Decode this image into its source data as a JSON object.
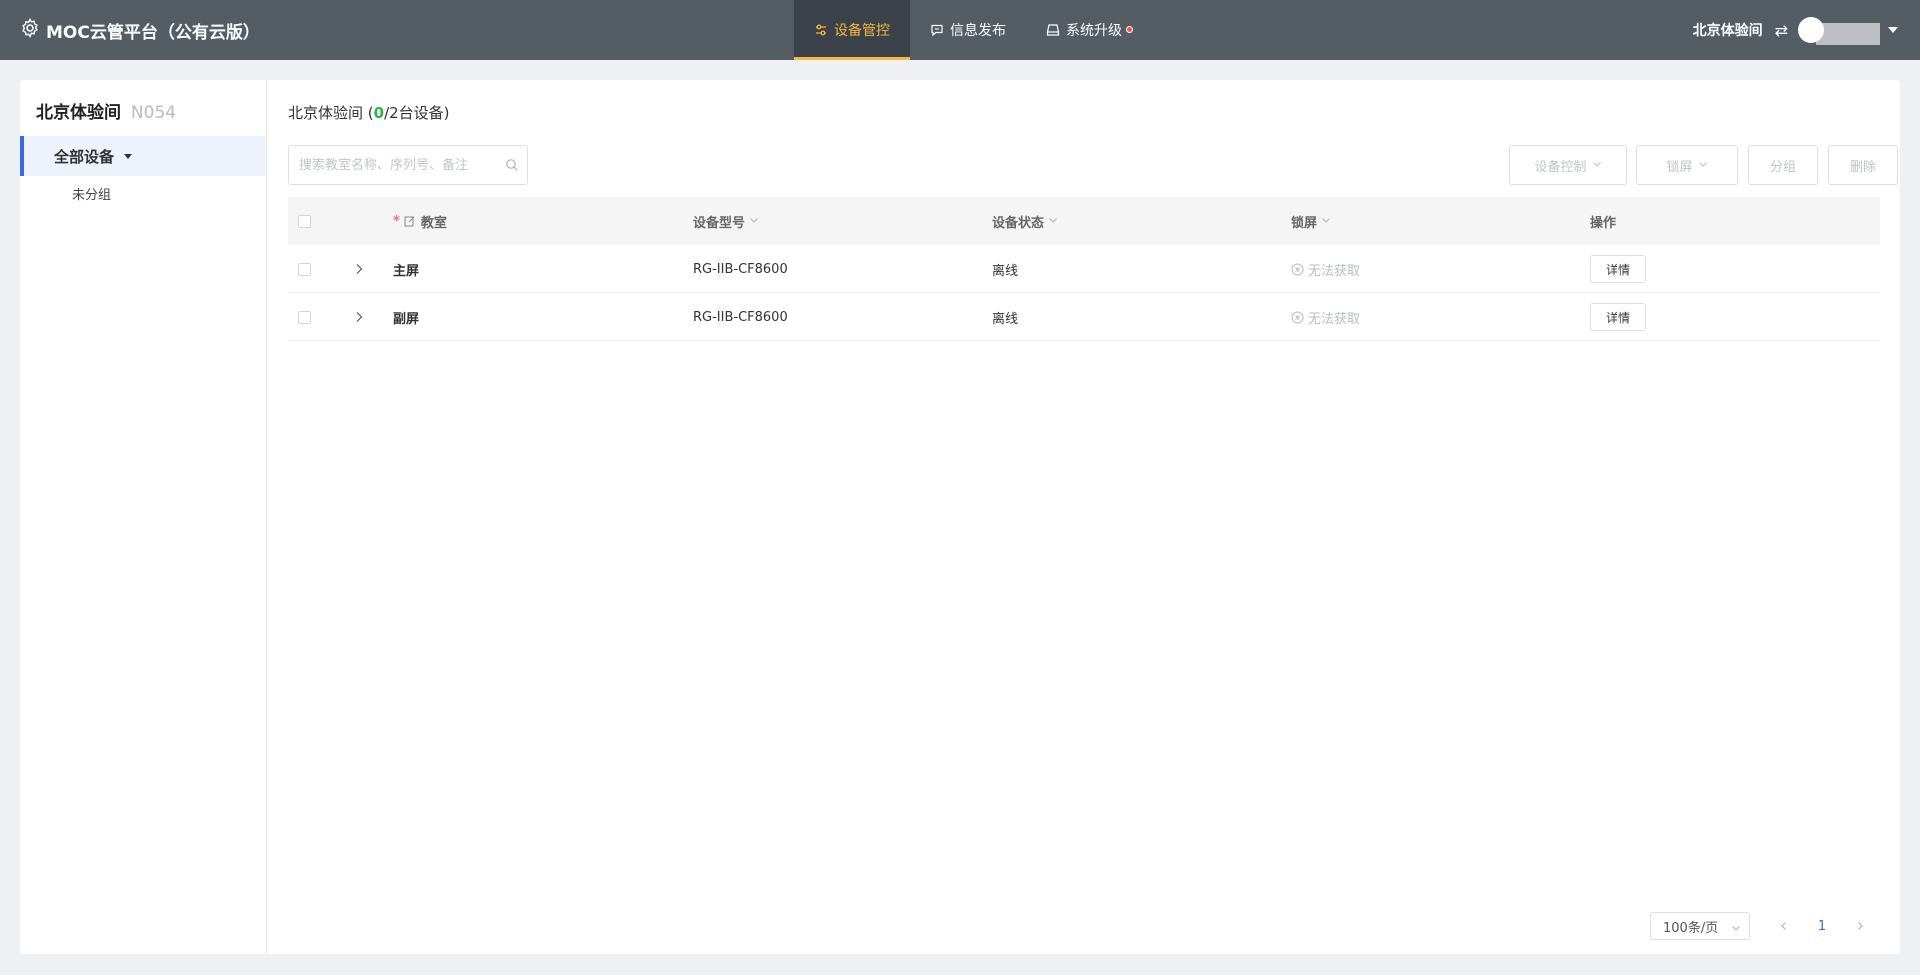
{
  "app": {
    "title": "MOC云管平台（公有云版）",
    "brand_icon": "gear-icon"
  },
  "nav": {
    "items": [
      {
        "label": "设备管控",
        "icon": "sliders-icon",
        "active": true
      },
      {
        "label": "信息发布",
        "icon": "message-icon",
        "active": false
      },
      {
        "label": "系统升级",
        "icon": "upgrade-icon",
        "active": false,
        "badge": true
      }
    ]
  },
  "user": {
    "org": "北京体验间",
    "switch_icon": "swap-icon"
  },
  "sidebar": {
    "title": "北京体验间",
    "code": "N054",
    "all_devices": "全部设备",
    "ungrouped": "未分组"
  },
  "main": {
    "heading_prefix": "北京体验间 (",
    "online_count": "0",
    "heading_suffix": "/2台设备)",
    "search_placeholder": "搜索教室名称、序列号、备注",
    "buttons": {
      "device_control": "设备控制",
      "lock_screen": "锁屏",
      "group": "分组",
      "delete": "删除"
    }
  },
  "table": {
    "columns": {
      "classroom": "教室",
      "model": "设备型号",
      "status": "设备状态",
      "lock": "锁屏",
      "action": "操作"
    },
    "rows": [
      {
        "name": "主屏",
        "model": "RG-IIB-CF8600",
        "status": "离线",
        "lock": "无法获取",
        "action": "详情"
      },
      {
        "name": "副屏",
        "model": "RG-IIB-CF8600",
        "status": "离线",
        "lock": "无法获取",
        "action": "详情"
      }
    ]
  },
  "pagination": {
    "page_size": "100条/页",
    "current_page": "1"
  },
  "colors": {
    "topbar": "#545c64",
    "accent": "#f5b83d",
    "primary": "#3d6ae0",
    "online": "#2fb344"
  }
}
